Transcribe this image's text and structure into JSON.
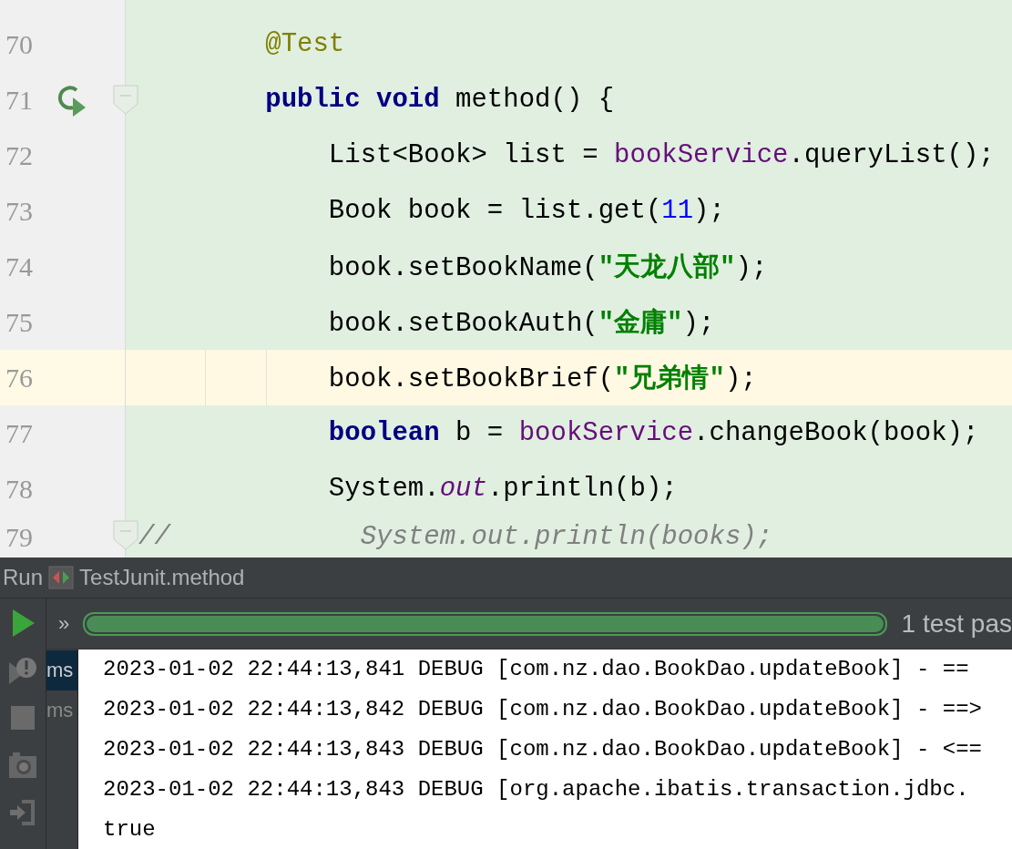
{
  "editor": {
    "lines": [
      {
        "number": "70",
        "current": false,
        "run_marker": false,
        "fold_marker": false,
        "tokens": [
          {
            "kind": "annotation",
            "text": "        @Test"
          }
        ]
      },
      {
        "number": "71",
        "current": false,
        "run_marker": true,
        "fold_marker": true,
        "tokens": [
          {
            "kind": "keyword",
            "text": "        public void"
          },
          {
            "kind": "plain",
            "text": " method() {"
          }
        ]
      },
      {
        "number": "72",
        "current": false,
        "run_marker": false,
        "fold_marker": false,
        "tokens": [
          {
            "kind": "plain",
            "text": "            List<Book> list = "
          },
          {
            "kind": "field",
            "text": "bookService"
          },
          {
            "kind": "plain",
            "text": ".queryList();"
          }
        ]
      },
      {
        "number": "73",
        "current": false,
        "run_marker": false,
        "fold_marker": false,
        "tokens": [
          {
            "kind": "plain",
            "text": "            Book book = list.get("
          },
          {
            "kind": "number",
            "text": "11"
          },
          {
            "kind": "plain",
            "text": ");"
          }
        ]
      },
      {
        "number": "74",
        "current": false,
        "run_marker": false,
        "fold_marker": false,
        "tokens": [
          {
            "kind": "plain",
            "text": "            book.setBookName("
          },
          {
            "kind": "string",
            "text": "\"天龙八部\""
          },
          {
            "kind": "plain",
            "text": ");"
          }
        ]
      },
      {
        "number": "75",
        "current": false,
        "run_marker": false,
        "fold_marker": false,
        "tokens": [
          {
            "kind": "plain",
            "text": "            book.setBookAuth("
          },
          {
            "kind": "string",
            "text": "\"金庸\""
          },
          {
            "kind": "plain",
            "text": ");"
          }
        ]
      },
      {
        "number": "76",
        "current": true,
        "run_marker": false,
        "fold_marker": false,
        "tokens": [
          {
            "kind": "plain",
            "text": "            book.setBookBrief("
          },
          {
            "kind": "string",
            "text": "\"兄弟情\""
          },
          {
            "kind": "plain",
            "text": ");"
          }
        ]
      },
      {
        "number": "77",
        "current": false,
        "run_marker": false,
        "fold_marker": false,
        "tokens": [
          {
            "kind": "keyword",
            "text": "            boolean"
          },
          {
            "kind": "plain",
            "text": " b = "
          },
          {
            "kind": "field",
            "text": "bookService"
          },
          {
            "kind": "plain",
            "text": ".changeBook(book);"
          }
        ]
      },
      {
        "number": "78",
        "current": false,
        "run_marker": false,
        "fold_marker": false,
        "tokens": [
          {
            "kind": "plain",
            "text": "            System."
          },
          {
            "kind": "static",
            "text": "out"
          },
          {
            "kind": "plain",
            "text": ".println(b);"
          }
        ]
      },
      {
        "number": "79",
        "current": false,
        "run_marker": false,
        "fold_marker": true,
        "tokens": [
          {
            "kind": "comment",
            "text": "//            System.out.println(books);"
          }
        ]
      }
    ]
  },
  "run_panel": {
    "label": "Run",
    "tab_title": "TestJunit.method",
    "overflow": "»",
    "progress": {
      "level": 1
    },
    "status": "1 test pas",
    "tree_items": [
      {
        "text": "ms",
        "selected": true
      },
      {
        "text": "ms",
        "selected": false
      }
    ],
    "console_lines": [
      "2023-01-02 22:44:13,841 DEBUG [com.nz.dao.BookDao.updateBook] - ==",
      "2023-01-02 22:44:13,842 DEBUG [com.nz.dao.BookDao.updateBook] - ==>",
      "2023-01-02 22:44:13,843 DEBUG [com.nz.dao.BookDao.updateBook] - <==",
      "2023-01-02 22:44:13,843 DEBUG [org.apache.ibatis.transaction.jdbc.",
      "true"
    ]
  }
}
